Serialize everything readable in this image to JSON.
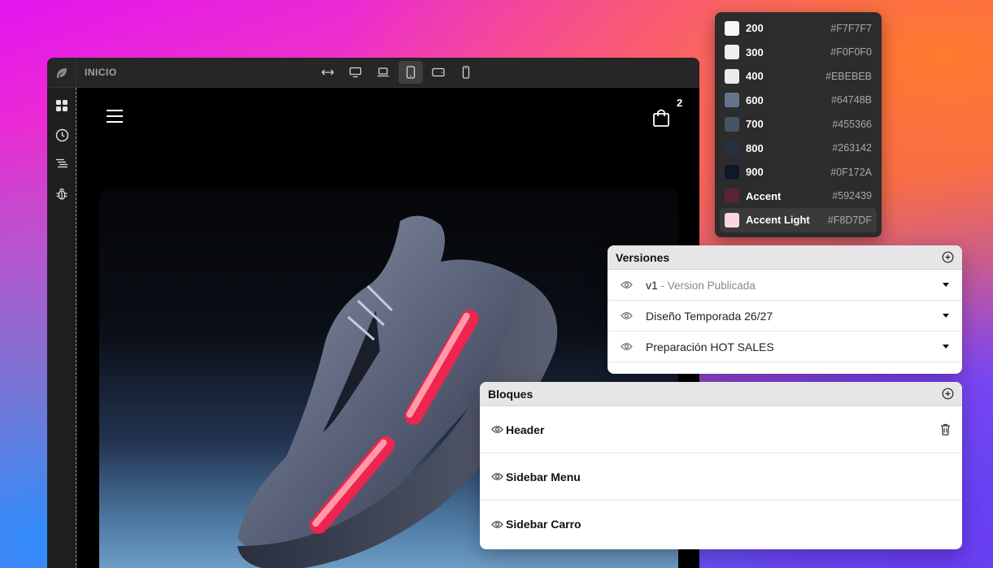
{
  "editor": {
    "page_name": "INICIO",
    "cart_count": "2",
    "devices": [
      "fit-width-icon",
      "desktop-icon",
      "laptop-icon",
      "tablet-icon",
      "tablet-landscape-icon",
      "mobile-icon"
    ],
    "active_device": "tablet-icon"
  },
  "palette": {
    "items": [
      {
        "name": "200",
        "hex": "#F7F7F7",
        "color": "#F7F7F7"
      },
      {
        "name": "300",
        "hex": "#F0F0F0",
        "color": "#F0F0F0"
      },
      {
        "name": "400",
        "hex": "#EBEBEB",
        "color": "#EBEBEB"
      },
      {
        "name": "600",
        "hex": "#64748B",
        "color": "#64748B"
      },
      {
        "name": "700",
        "hex": "#455366",
        "color": "#455366"
      },
      {
        "name": "800",
        "hex": "#263142",
        "color": "#263142"
      },
      {
        "name": "900",
        "hex": "#0F172A",
        "color": "#0F172A"
      },
      {
        "name": "Accent",
        "hex": "#592439",
        "color": "#592439"
      },
      {
        "name": "Accent Light",
        "hex": "#F8D7DF",
        "color": "#F8D7DF"
      }
    ]
  },
  "versions": {
    "title": "Versiones",
    "items": [
      {
        "label": "v1",
        "sub": " - Version Publicada"
      },
      {
        "label": "Diseño Temporada 26/27",
        "sub": ""
      },
      {
        "label": "Preparación HOT SALES",
        "sub": ""
      }
    ]
  },
  "blocks": {
    "title": "Bloques",
    "items": [
      {
        "label": "Header"
      },
      {
        "label": "Sidebar Menu"
      },
      {
        "label": "Sidebar Carro"
      }
    ]
  }
}
